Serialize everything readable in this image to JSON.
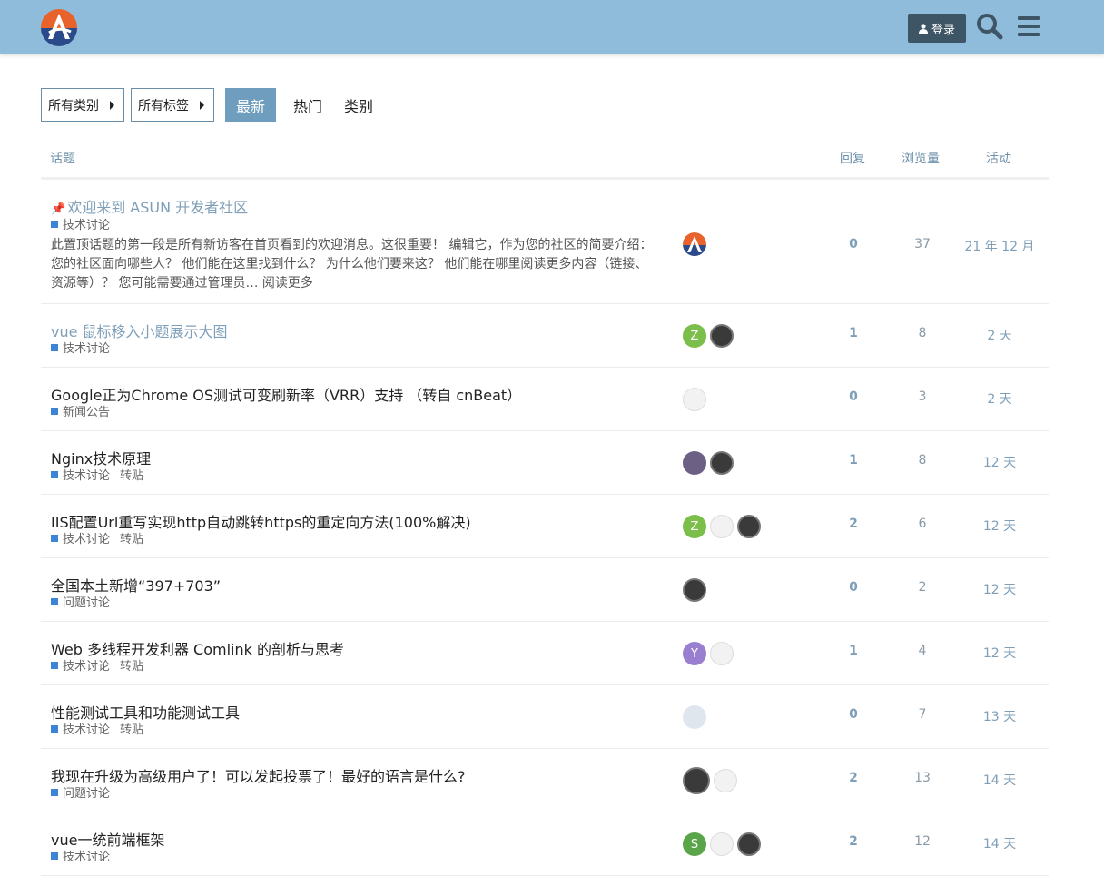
{
  "header": {
    "login_label": "登录",
    "colors": {
      "bg": "#8fbcdb",
      "login_bg": "#3e5566"
    }
  },
  "nav": {
    "categories_dropdown": "所有类别",
    "tags_dropdown": "所有标签",
    "tabs": [
      "最新",
      "热门",
      "类别"
    ]
  },
  "table": {
    "headers": {
      "topic": "话题",
      "replies": "回复",
      "views": "浏览量",
      "activity": "活动"
    },
    "rows": [
      {
        "title": "欢迎来到 ASUN 开发者社区",
        "pinned": true,
        "visited": true,
        "category": "技术讨论",
        "tags": [],
        "excerpt": "此置顶话题的第一段是所有新访客在首页看到的欢迎消息。这很重要！ 编辑它，作为您的社区的简要介绍： 您的社区面向哪些人？ 他们能在这里找到什么？ 为什么他们要来这？ 他们能在哪里阅读更多内容（链接、资源等）？ 您可能需要通过管理员… ",
        "readmore": "阅读更多",
        "posters": [
          "logo"
        ],
        "replies": "0",
        "views": "37",
        "activity": "21 年 12 月"
      },
      {
        "title": "vue 鼠标移入小题展示大图",
        "visited": true,
        "category": "技术讨论",
        "tags": [],
        "posters": [
          "Z",
          "dark"
        ],
        "replies": "1",
        "views": "8",
        "activity": "2 天"
      },
      {
        "title": "Google正为Chrome OS测试可变刷新率（VRR）支持 （转自 cnBeat）",
        "category": "新闻公告",
        "tags": [],
        "posters": [
          "cloud"
        ],
        "replies": "0",
        "views": "3",
        "activity": "2 天"
      },
      {
        "title": "Nginx技术原理",
        "category": "技术讨论",
        "tags": [
          "转贴"
        ],
        "posters": [
          "purple",
          "dark"
        ],
        "replies": "1",
        "views": "8",
        "activity": "12 天"
      },
      {
        "title": "IIS配置Url重写实现http自动跳转https的重定向方法(100%解决)",
        "category": "技术讨论",
        "tags": [
          "转贴"
        ],
        "posters": [
          "Z",
          "cloud",
          "dark"
        ],
        "replies": "2",
        "views": "6",
        "activity": "12 天"
      },
      {
        "title": "全国本土新增“397+703”",
        "category": "问题讨论",
        "tags": [],
        "posters": [
          "dark"
        ],
        "replies": "0",
        "views": "2",
        "activity": "12 天"
      },
      {
        "title": "Web 多线程开发利器 Comlink 的剖析与思考",
        "category": "技术讨论",
        "tags": [
          "转贴"
        ],
        "posters": [
          "Y",
          "cloud"
        ],
        "replies": "1",
        "views": "4",
        "activity": "12 天"
      },
      {
        "title": "性能测试工具和功能测试工具",
        "category": "技术讨论",
        "tags": [
          "转贴"
        ],
        "posters": [
          "bluecar"
        ],
        "replies": "0",
        "views": "7",
        "activity": "13 天"
      },
      {
        "title": "我现在升级为高级用户了！可以发起投票了！最好的语言是什么?",
        "category": "问题讨论",
        "tags": [],
        "posters": [
          "dark",
          "cloud"
        ],
        "replies": "2",
        "views": "13",
        "activity": "14 天"
      },
      {
        "title": "vue一统前端框架",
        "category": "技术讨论",
        "tags": [],
        "posters": [
          "S",
          "cloud",
          "dark"
        ],
        "replies": "2",
        "views": "12",
        "activity": "14 天"
      }
    ]
  }
}
